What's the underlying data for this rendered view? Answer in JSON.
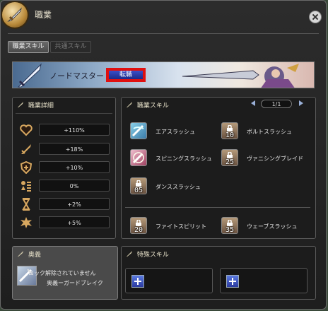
{
  "window": {
    "title": "職業"
  },
  "tabs": [
    {
      "label": "職業スキル",
      "active": true
    },
    {
      "label": "共通スキル",
      "active": false
    }
  ],
  "job": {
    "name": "ノードマスター",
    "change_button": "転職"
  },
  "details": {
    "heading": "職業詳細",
    "stats": [
      {
        "icon": "heart-icon",
        "value": "+110%"
      },
      {
        "icon": "sword-icon",
        "value": "+18%"
      },
      {
        "icon": "shield-icon",
        "value": "+10%"
      },
      {
        "icon": "list-icon",
        "value": "0%"
      },
      {
        "icon": "hourglass-icon",
        "value": "+2%"
      },
      {
        "icon": "impact-icon",
        "value": "+5%"
      }
    ]
  },
  "skills": {
    "heading": "職業スキル",
    "page": "1/1",
    "items": [
      {
        "name": "エアスラッシュ",
        "level": ""
      },
      {
        "name": "ボルトスラッシュ",
        "level": "10"
      },
      {
        "name": "スピニングスラッシュ",
        "level": ""
      },
      {
        "name": "ヴァニシングブレイド",
        "level": "25"
      },
      {
        "name": "ダンススラッシュ",
        "level": "05"
      },
      {
        "name": "ファイトスピリット",
        "level": "20"
      },
      {
        "name": "ウェーブスラッシュ",
        "level": "35"
      }
    ]
  },
  "secret": {
    "heading": "奥義",
    "status": "ロック解除されていません",
    "name": "奥義ーガードブレイク"
  },
  "special": {
    "heading": "特殊スキル"
  },
  "colors": {
    "highlight": "#e01010",
    "panel_bg": "#1c1c1c",
    "text": "#e6e0c8"
  }
}
